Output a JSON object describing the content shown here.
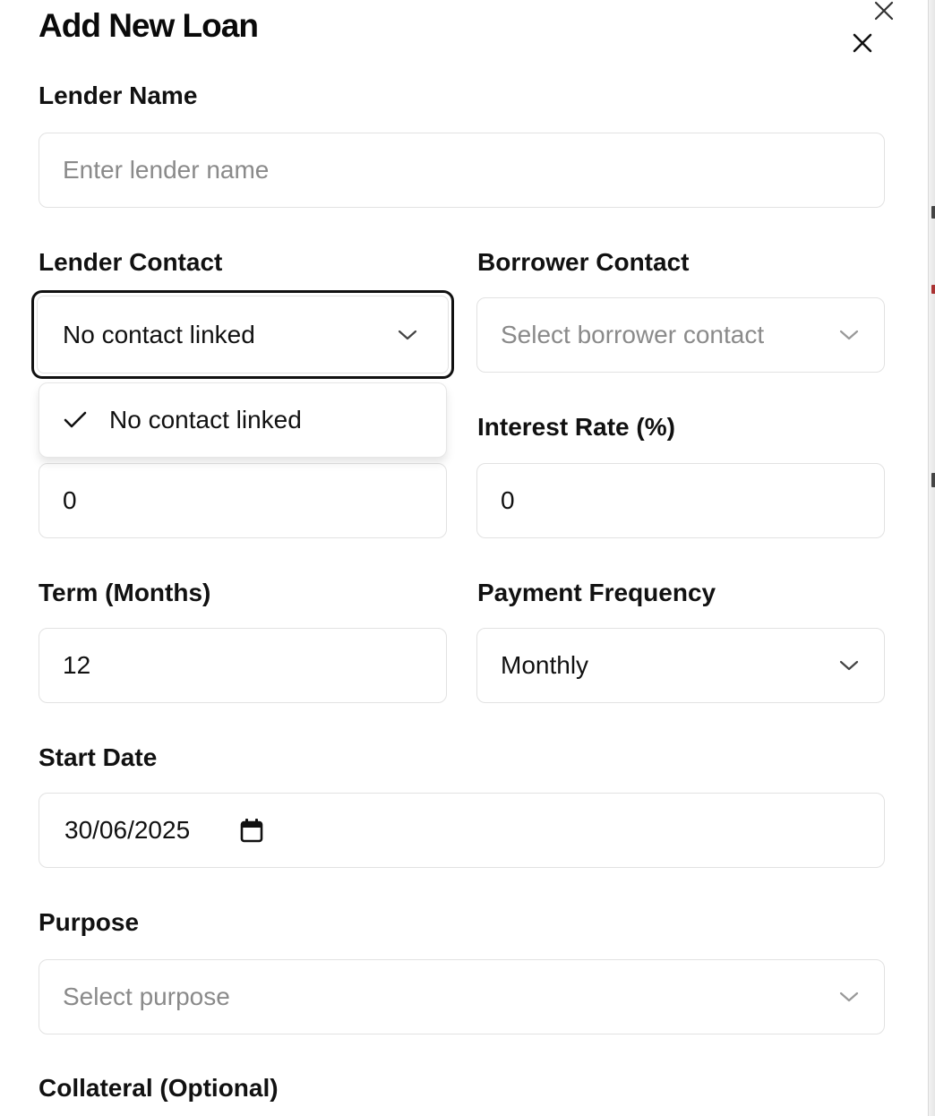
{
  "dialog": {
    "title": "Add New Loan"
  },
  "fields": {
    "lender_name": {
      "label": "Lender Name",
      "placeholder": "Enter lender name",
      "value": ""
    },
    "lender_contact": {
      "label": "Lender Contact",
      "value": "No contact linked"
    },
    "borrower_contact": {
      "label": "Borrower Contact",
      "placeholder": "Select borrower contact"
    },
    "principal": {
      "value": "0"
    },
    "interest_rate": {
      "label": "Interest Rate (%)",
      "value": "0"
    },
    "term_months": {
      "label": "Term (Months)",
      "value": "12"
    },
    "payment_frequency": {
      "label": "Payment Frequency",
      "value": "Monthly"
    },
    "start_date": {
      "label": "Start Date",
      "value": "30/06/2025"
    },
    "purpose": {
      "label": "Purpose",
      "placeholder": "Select purpose"
    },
    "collateral": {
      "label": "Collateral (Optional)"
    }
  },
  "lender_contact_dropdown": {
    "options": [
      {
        "label": "No contact linked",
        "selected": true
      }
    ]
  },
  "icons": {
    "close": "close-icon",
    "chevron": "chevron-down-icon",
    "check": "check-icon",
    "calendar": "calendar-icon"
  }
}
